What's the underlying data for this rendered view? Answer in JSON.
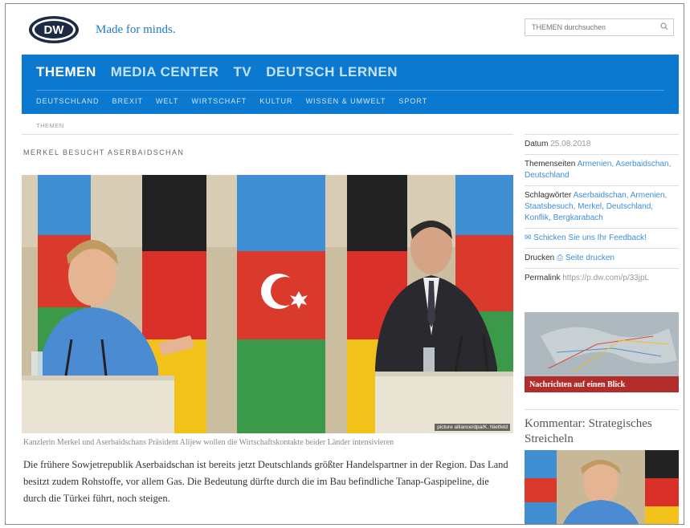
{
  "header": {
    "logo_text": "DW",
    "tagline": "Made for minds.",
    "search_placeholder": "THEMEN durchsuchen"
  },
  "nav": {
    "main": [
      "THEMEN",
      "MEDIA CENTER",
      "TV",
      "DEUTSCH LERNEN"
    ],
    "sub": [
      "DEUTSCHLAND",
      "BREXIT",
      "WELT",
      "WIRTSCHAFT",
      "KULTUR",
      "WISSEN & UMWELT",
      "SPORT"
    ]
  },
  "breadcrumb": "THEMEN",
  "article": {
    "kicker": "MERKEL BESUCHT ASERBAIDSCHAN",
    "photo_credit": "picture alliance/dpa/K. Nietfeld",
    "caption": "Kanzlerin Merkel und Aserbaidschans Präsident Alijew wollen die Wirtschaftskontakte beider Länder intensivieren",
    "lead": "Die frühere Sowjetrepublik Aserbaidschan ist bereits jetzt Deutschlands größter Handelspartner in der Region. Das Land besitzt zudem Rohstoffe, vor allem Gas. Die Bedeutung dürfte durch die im Bau befindliche Tanap-Gaspipeline, die durch die Türkei führt, noch steigen."
  },
  "sidebar": {
    "date_label": "Datum",
    "date_value": "25.08.2018",
    "topics_label": "Themenseiten",
    "topics_value": "Armenien, Aserbaidschan, Deutschland",
    "tags_label": "Schlagwörter",
    "tags_value": "Aserbaidschan, Armenien, Staatsbesuch, Merkel, Deutschland, Konflik, Bergkarabach",
    "feedback": "Schicken Sie uns Ihr Feedback!",
    "print_label": "Drucken",
    "print_link": "Seite drucken",
    "permalink_label": "Permalink",
    "permalink_value": "https://p.dw.com/p/33jpL",
    "teaser1_label": "Nachrichten auf einen Blick",
    "kommentar_title": "Kommentar: Strategisches Streicheln"
  },
  "colors": {
    "nav_blue": "#0b79cf",
    "link_blue": "#3e8ed6",
    "teaser_red": "#b22d2a"
  }
}
